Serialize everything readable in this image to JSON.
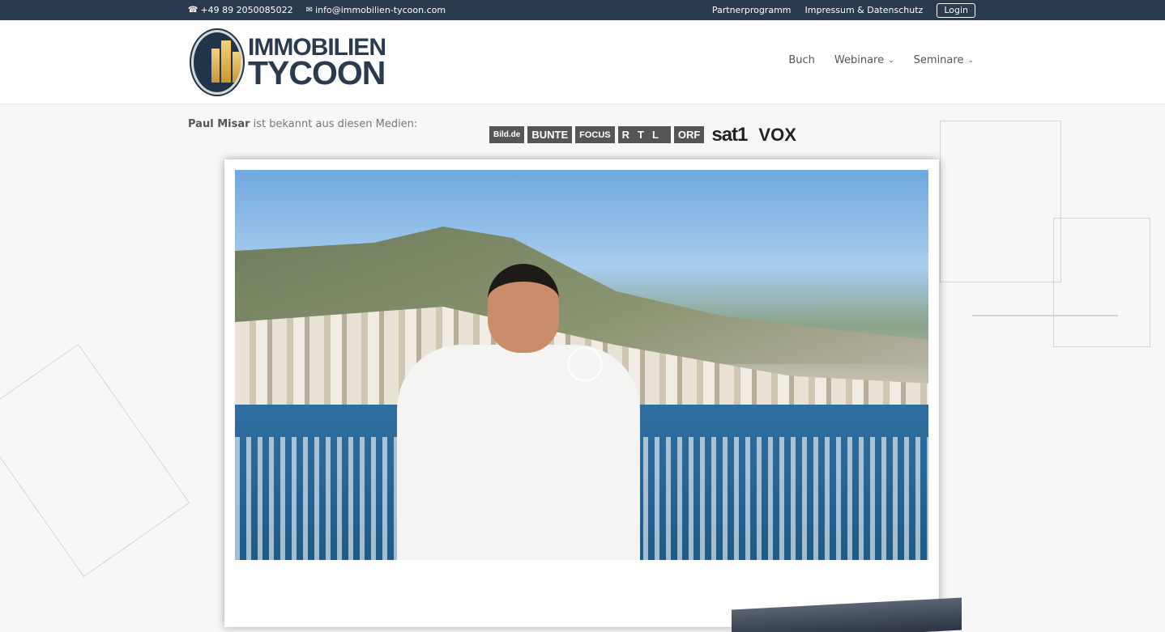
{
  "topbar": {
    "phone": "+49 89 2050085022",
    "email": "info@immobilien-tycoon.com",
    "links": [
      "Partnerprogramm",
      "Impressum & Datenschutz"
    ],
    "login": "Login"
  },
  "header": {
    "logo_line1": "IMMOBILIEN",
    "logo_line2": "TYCOON",
    "nav": [
      {
        "label": "Buch"
      },
      {
        "label": "Webinare"
      },
      {
        "label": "Seminare"
      }
    ]
  },
  "content": {
    "media_name": "Paul Misar",
    "media_text": " ist bekannt aus diesen Medien:",
    "media_logos": [
      "Bild.de",
      "BUNTE",
      "FOCUS",
      "RTL",
      "ORF",
      "sat1",
      "VOX"
    ]
  },
  "colors": {
    "topbar_bg": "#2b3a4e",
    "brand_dark": "#2b3a4e",
    "brand_gold": "#d9ae4a"
  }
}
